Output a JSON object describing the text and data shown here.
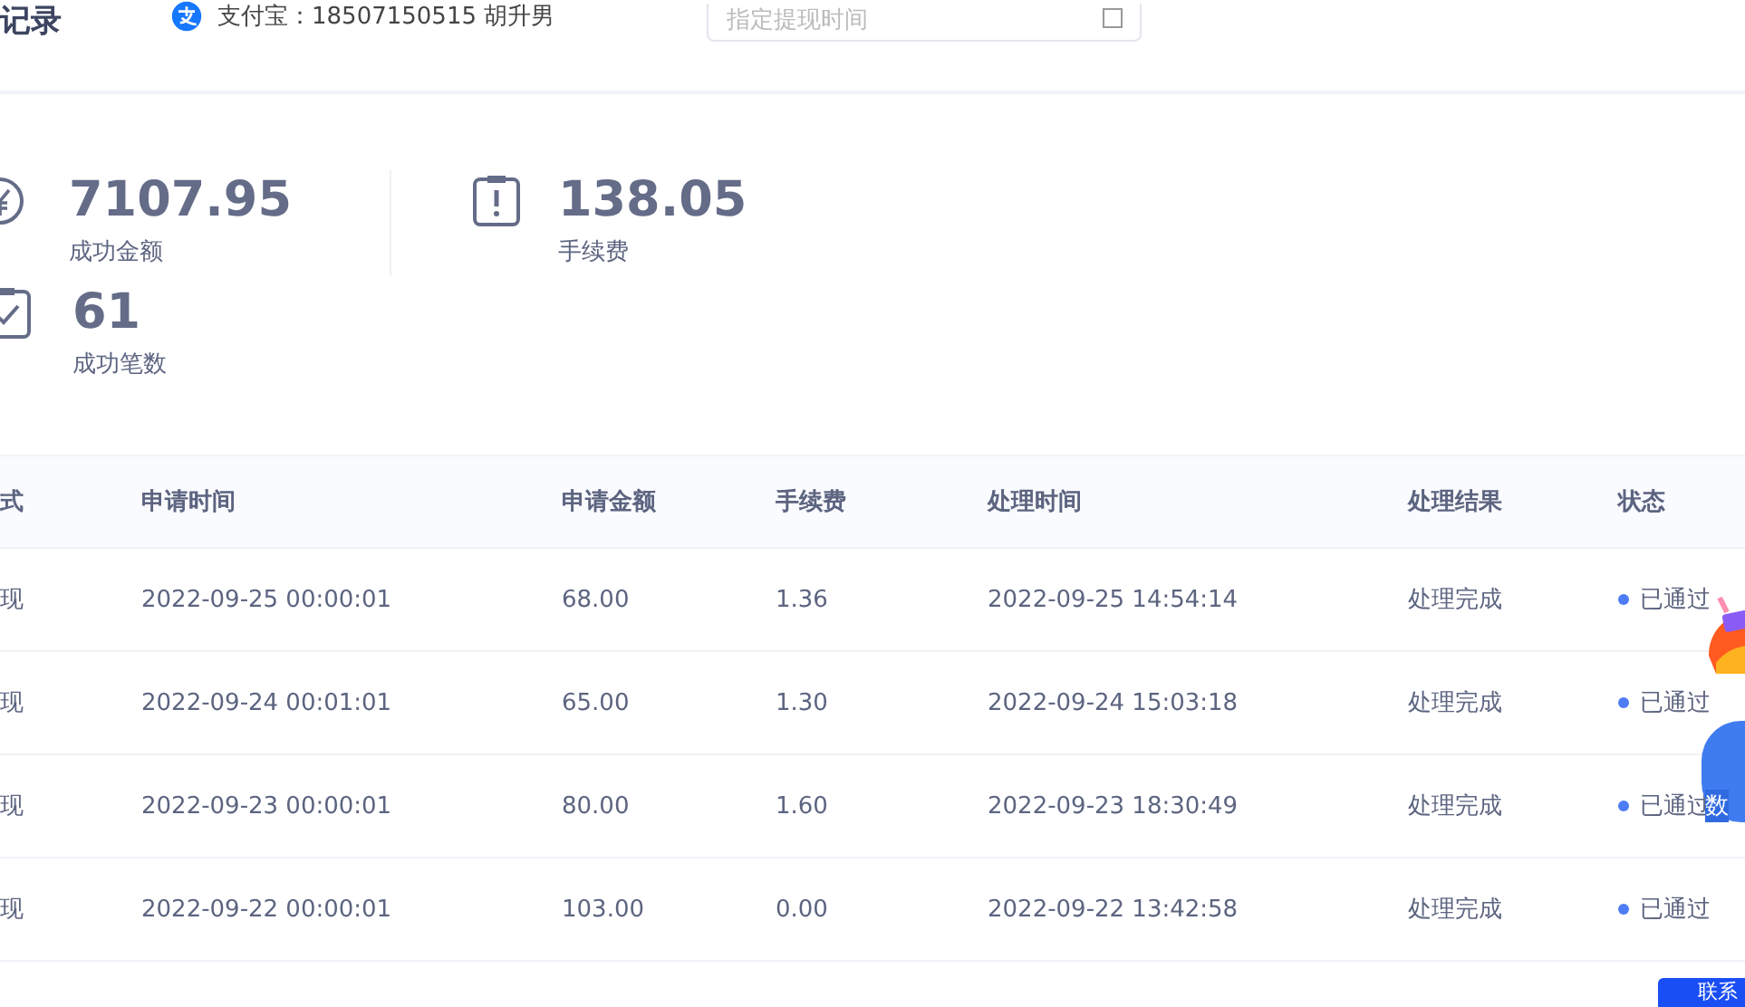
{
  "header": {
    "title": "记录",
    "account": "支付宝：18507150515 胡升男",
    "date_field": {
      "placeholder": "指定提现时间"
    }
  },
  "stats": [
    {
      "kind": "yen",
      "value": "7107.95",
      "label": "成功金额"
    },
    {
      "kind": "alert",
      "value": "138.05",
      "label": "手续费"
    },
    {
      "kind": "check",
      "value": "61",
      "label": "成功笔数"
    }
  ],
  "table": {
    "columns": [
      "式",
      "申请时间",
      "申请金额",
      "手续费",
      "处理时间",
      "处理结果",
      "状态"
    ],
    "rows": [
      {
        "method": "现",
        "applied": "2022-09-25 00:00:01",
        "amount": "68.00",
        "fee": "1.36",
        "processed": "2022-09-25 14:54:14",
        "result": "处理完成",
        "status": "已通过",
        "color": "#4d7cf5"
      },
      {
        "method": "现",
        "applied": "2022-09-24 00:01:01",
        "amount": "65.00",
        "fee": "1.30",
        "processed": "2022-09-24 15:03:18",
        "result": "处理完成",
        "status": "已通过",
        "color": "#4d7cf5"
      },
      {
        "method": "现",
        "applied": "2022-09-23 00:00:01",
        "amount": "80.00",
        "fee": "1.60",
        "processed": "2022-09-23 18:30:49",
        "result": "处理完成",
        "status": "已通过",
        "color": "#4d7cf5"
      },
      {
        "method": "现",
        "applied": "2022-09-22 00:00:01",
        "amount": "103.00",
        "fee": "0.00",
        "processed": "2022-09-22 13:42:58",
        "result": "处理完成",
        "status": "已通过",
        "color": "#4d7cf5"
      }
    ]
  },
  "float_widgets": {
    "badge_label": "数",
    "contact_button": "联系"
  }
}
